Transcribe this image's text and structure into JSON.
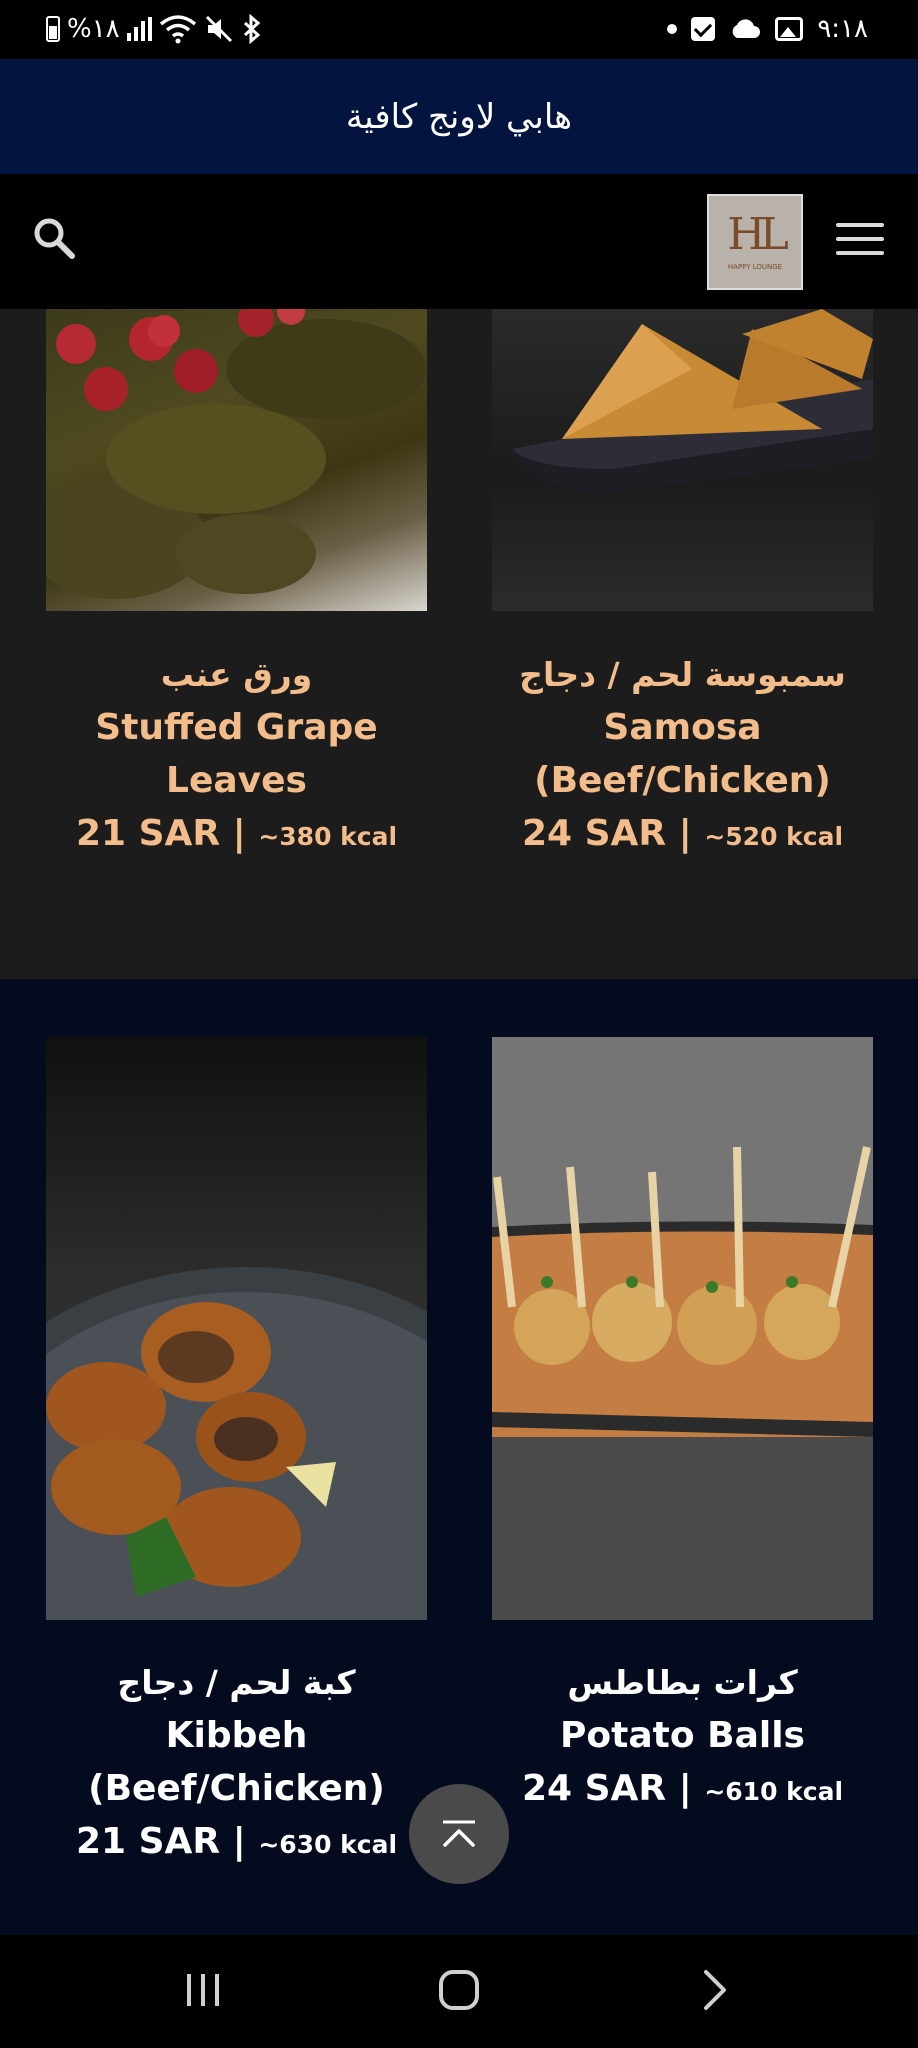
{
  "status_bar": {
    "battery": "%١٨",
    "time": "٩:١٨"
  },
  "app": {
    "title": "هابي لاونج كافية"
  },
  "header": {
    "logo_mark": "HL",
    "logo_subtitle": "HAPPY LOUNGE"
  },
  "menu_items": [
    {
      "name_ar": "ورق عنب",
      "name_en": "Stuffed Grape Leaves",
      "price": "21 SAR",
      "separator": "|",
      "calories": "~380 kcal"
    },
    {
      "name_ar": "سمبوسة لحم / دجاج",
      "name_en": "Samosa (Beef/Chicken)",
      "price": "24 SAR",
      "separator": "|",
      "calories": "~520 kcal"
    },
    {
      "name_ar": "كبة لحم / دجاج",
      "name_en": "Kibbeh (Beef/Chicken)",
      "price": "21 SAR",
      "separator": "|",
      "calories": "~630 kcal"
    },
    {
      "name_ar": "كرات بطاطس",
      "name_en": "Potato Balls",
      "price": "24 SAR",
      "separator": "|",
      "calories": "~610 kcal"
    }
  ],
  "colors": {
    "banner_bg": "#03143f",
    "section_dark_bg": "#1c1c1c",
    "section_navy_bg": "#040b1f",
    "accent_text": "#f2bd8a"
  },
  "icons": {
    "search": "search-icon",
    "menu": "hamburger-menu-icon",
    "back_to_top": "chevron-up-icon"
  }
}
